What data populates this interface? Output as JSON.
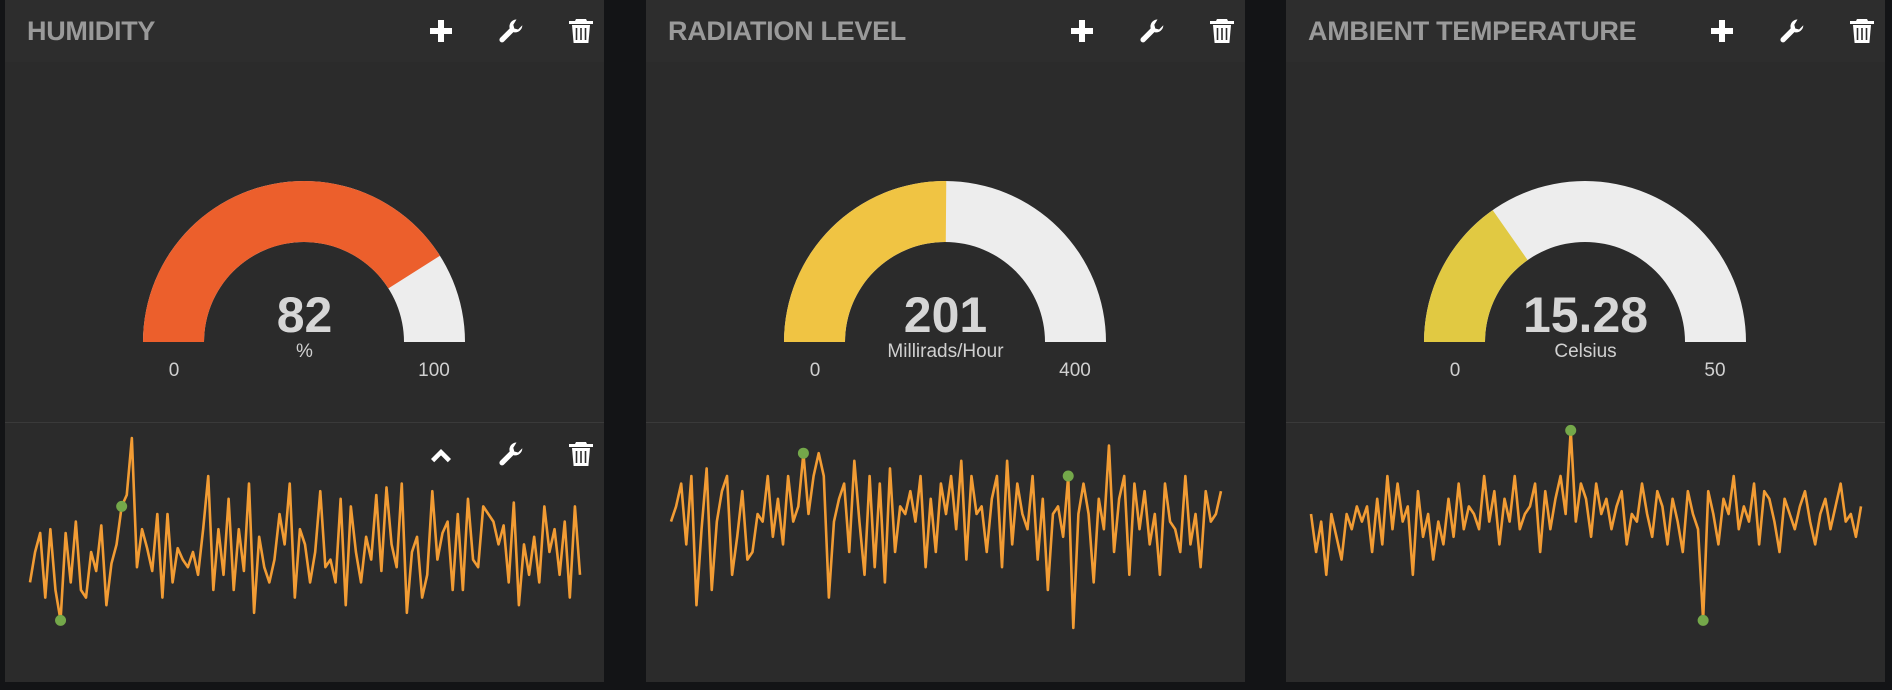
{
  "colors": {
    "background": "#131416",
    "pane": "#2b2b2b",
    "track": "#ededed",
    "sparkline": "#f29c34",
    "marker": "#74a84a"
  },
  "panes": [
    {
      "title": "HUMIDITY",
      "header_icons": [
        "plus-icon",
        "wrench-icon",
        "trash-icon"
      ],
      "widget_icons": [
        "chevron-up-icon",
        "wrench-icon",
        "trash-icon"
      ],
      "gauge": {
        "value": "82",
        "units": "%",
        "min": "0",
        "max": "100",
        "fraction": 0.82,
        "color": "#ec5f2c"
      },
      "sparkline": {
        "values": [
          12,
          20,
          25,
          8,
          26,
          10,
          2,
          25,
          12,
          28,
          10,
          8,
          20,
          15,
          27,
          6,
          17,
          22,
          32,
          35,
          50,
          16,
          26,
          21,
          15,
          30,
          8,
          30,
          12,
          21,
          18,
          16,
          20,
          14,
          26,
          40,
          10,
          26,
          14,
          34,
          10,
          26,
          15,
          38,
          4,
          24,
          16,
          12,
          18,
          30,
          22,
          38,
          8,
          26,
          22,
          12,
          20,
          36,
          16,
          18,
          12,
          34,
          6,
          32,
          20,
          12,
          24,
          18,
          35,
          15,
          37,
          22,
          16,
          38,
          4,
          20,
          24,
          8,
          14,
          36,
          18,
          25,
          28,
          10,
          30,
          10,
          34,
          18,
          16,
          32,
          30,
          28,
          22,
          27,
          12,
          33,
          6,
          22,
          14,
          24,
          12,
          32,
          20,
          26,
          14,
          28,
          8,
          32,
          14
        ],
        "highlight": [
          6,
          18
        ]
      }
    },
    {
      "title": "RADIATION LEVEL",
      "header_icons": [
        "plus-icon",
        "wrench-icon",
        "trash-icon"
      ],
      "widget_icons": [],
      "gauge": {
        "value": "201",
        "units": "Millirads/Hour",
        "min": "0",
        "max": "400",
        "fraction": 0.5025,
        "color": "#f0c443"
      },
      "sparkline": {
        "values": [
          28,
          32,
          38,
          22,
          40,
          6,
          26,
          42,
          10,
          28,
          36,
          40,
          14,
          24,
          36,
          18,
          20,
          30,
          28,
          40,
          24,
          34,
          22,
          40,
          28,
          32,
          46,
          30,
          40,
          46,
          40,
          8,
          28,
          34,
          38,
          20,
          44,
          28,
          14,
          40,
          16,
          38,
          12,
          42,
          20,
          32,
          30,
          36,
          28,
          40,
          16,
          34,
          20,
          38,
          30,
          40,
          26,
          44,
          18,
          40,
          30,
          32,
          20,
          34,
          40,
          16,
          44,
          22,
          38,
          30,
          26,
          40,
          18,
          34,
          10,
          30,
          32,
          24,
          40,
          0,
          30,
          38,
          30,
          12,
          34,
          26,
          48,
          20,
          34,
          40,
          14,
          38,
          26,
          36,
          22,
          30,
          14,
          38,
          28,
          26,
          20,
          40,
          22,
          30,
          16,
          36,
          28,
          30,
          36
        ],
        "highlight": [
          26,
          78
        ]
      }
    },
    {
      "title": "AMBIENT TEMPERATURE",
      "header_icons": [
        "plus-icon",
        "wrench-icon",
        "trash-icon"
      ],
      "widget_icons": [],
      "gauge": {
        "value": "15.28",
        "units": "Celsius",
        "min": "0",
        "max": "50",
        "fraction": 0.3056,
        "color": "#e1c942"
      },
      "sparkline": {
        "values": [
          30,
          20,
          28,
          14,
          30,
          24,
          18,
          30,
          26,
          32,
          28,
          32,
          20,
          34,
          22,
          40,
          26,
          38,
          28,
          32,
          14,
          36,
          24,
          30,
          18,
          28,
          22,
          34,
          24,
          38,
          26,
          32,
          30,
          26,
          40,
          28,
          36,
          22,
          34,
          28,
          40,
          26,
          30,
          32,
          38,
          20,
          36,
          26,
          34,
          40,
          30,
          52,
          28,
          38,
          34,
          24,
          38,
          30,
          34,
          26,
          32,
          36,
          22,
          30,
          28,
          38,
          30,
          24,
          36,
          32,
          22,
          34,
          28,
          20,
          36,
          30,
          26,
          2,
          36,
          30,
          22,
          34,
          30,
          40,
          26,
          32,
          28,
          38,
          22,
          36,
          34,
          28,
          20,
          34,
          30,
          26,
          32,
          36,
          28,
          22,
          30,
          34,
          26,
          32,
          38,
          28,
          30,
          24,
          32
        ],
        "highlight": [
          51,
          77
        ]
      }
    }
  ]
}
